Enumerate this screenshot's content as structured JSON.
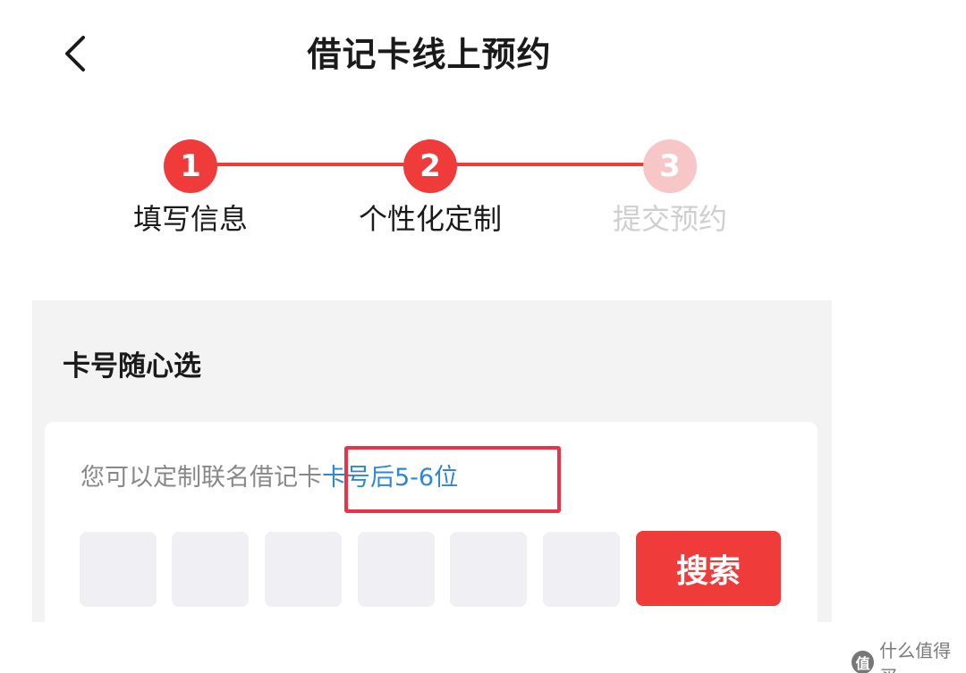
{
  "header": {
    "title": "借记卡线上预约"
  },
  "steps": [
    {
      "number": "1",
      "label": "填写信息",
      "state": "done"
    },
    {
      "number": "2",
      "label": "个性化定制",
      "state": "active"
    },
    {
      "number": "3",
      "label": "提交预约",
      "state": "pending"
    }
  ],
  "colors": {
    "accent": "#ef3b3a",
    "pending_circle": "#f7c6c6",
    "pending_text": "#cfcfcf",
    "link_blue": "#2f86d6",
    "highlight_border": "#e8334a"
  },
  "card_number_section": {
    "title": "卡号随心选",
    "hint_prefix": "您可以定制联名借记卡",
    "hint_highlight": "卡号后5-6位",
    "search_label": "搜索"
  },
  "watermark": {
    "logo_text": "值",
    "text": "什么值得买"
  }
}
